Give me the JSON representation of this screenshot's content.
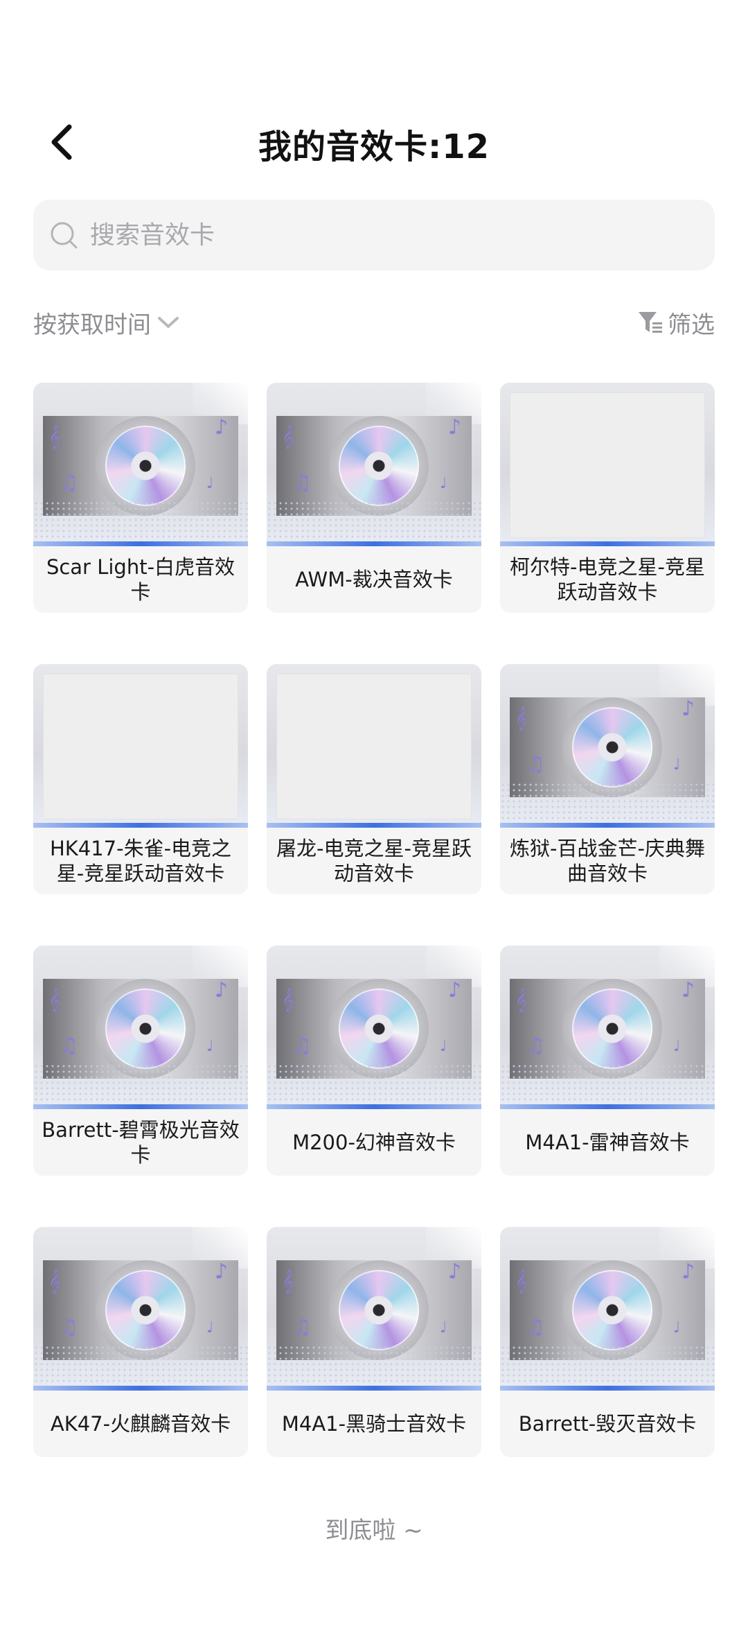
{
  "header": {
    "title": "我的音效卡:12"
  },
  "search": {
    "placeholder": "搜索音效卡"
  },
  "toolbar": {
    "sort_label": "按获取时间",
    "filter_label": "筛选"
  },
  "cards": [
    {
      "label": "Scar Light-白虎音效卡",
      "image": "sound-card-disc"
    },
    {
      "label": "AWM-裁决音效卡",
      "image": "sound-card-disc"
    },
    {
      "label": "柯尔特-电竞之星-竞星跃动音效卡",
      "image": "placeholder-blank"
    },
    {
      "label": "HK417-朱雀-电竞之星-竞星跃动音效卡",
      "image": "placeholder-blank"
    },
    {
      "label": "屠龙-电竞之星-竞星跃动音效卡",
      "image": "placeholder-blank"
    },
    {
      "label": "炼狱-百战金芒-庆典舞曲音效卡",
      "image": "sound-card-disc"
    },
    {
      "label": "Barrett-碧霄极光音效卡",
      "image": "sound-card-disc"
    },
    {
      "label": "M200-幻神音效卡",
      "image": "sound-card-disc"
    },
    {
      "label": "M4A1-雷神音效卡",
      "image": "sound-card-disc"
    },
    {
      "label": "AK47-火麒麟音效卡",
      "image": "sound-card-disc"
    },
    {
      "label": "M4A1-黑骑士音效卡",
      "image": "sound-card-disc"
    },
    {
      "label": "Barrett-毁灭音效卡",
      "image": "sound-card-disc"
    }
  ],
  "footer": {
    "end_text": "到底啦 ~"
  },
  "colors": {
    "title": "#111111",
    "muted_text": "#8d8d92",
    "search_bg": "#f4f4f5",
    "card_bg": "#f5f5f6",
    "accent_bar": "#3d6fe0"
  }
}
